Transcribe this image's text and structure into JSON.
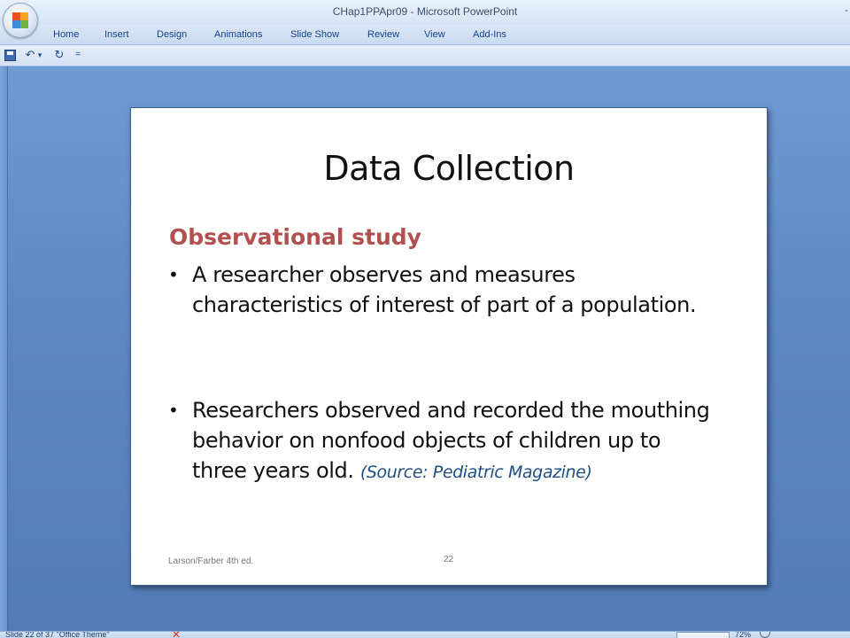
{
  "window": {
    "title": "CHap1PPApr09 - Microsoft PowerPoint",
    "edge_control": "-"
  },
  "ribbon": {
    "tabs": [
      "Home",
      "Insert",
      "Design",
      "Animations",
      "Slide Show",
      "Review",
      "View",
      "Add-Ins"
    ]
  },
  "quick_access": {
    "save_icon": "save-icon",
    "undo_icon": "↶",
    "undo_dropdown": "▾",
    "redo_icon": "↻",
    "customize": "="
  },
  "slide": {
    "title": "Data Collection",
    "subheading": "Observational study",
    "bullets": [
      {
        "marker": "•",
        "text": "A researcher observes and measures characteristics of interest of part of a population.",
        "note": ""
      },
      {
        "marker": "•",
        "text": "Researchers observed and recorded the mouthing behavior on nonfood objects of children up to three years old.",
        "note": "(Source: Pediatric Magazine)"
      }
    ],
    "footer": "Larson/Farber 4th ed.",
    "number": "22"
  },
  "statusbar": {
    "text": "Slide 22 of 37   \"Office Theme\"",
    "zoom": "72%"
  },
  "colors": {
    "subheading": "#b2504f",
    "source_note": "#1f4f82",
    "workspace": "#5f89c3"
  }
}
